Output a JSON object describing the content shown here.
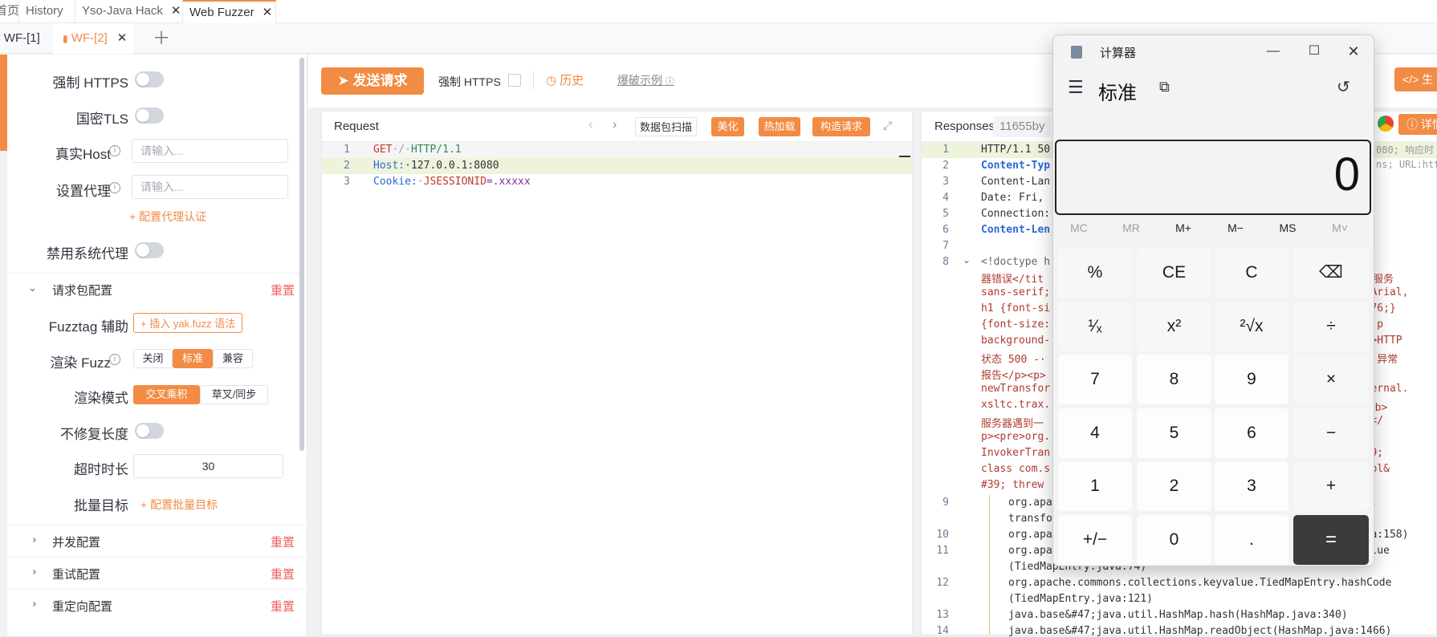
{
  "top_tabs": [
    {
      "label": "首页"
    },
    {
      "label": "History"
    },
    {
      "label": "Yso-Java Hack"
    },
    {
      "label": "Web Fuzzer"
    }
  ],
  "sub_tabs": [
    {
      "label": "WF-[1]"
    },
    {
      "label": "WF-[2]"
    }
  ],
  "left": {
    "force_https": "强制 HTTPS",
    "gm_tls": "国密TLS",
    "real_host": "真实Host",
    "real_host_placeholder": "请输入...",
    "proxy": "设置代理",
    "proxy_placeholder": "请输入...",
    "proxy_auth_link": "+ 配置代理认证",
    "disable_sys_proxy": "禁用系统代理",
    "req_pkg_config": "请求包配置",
    "reset": "重置",
    "fuzztag_helper": "Fuzztag 辅助",
    "insert_fuzz": "+ 插入 yak.fuzz 语法",
    "render_fuzz": "渲染 Fuzz",
    "render_opts": [
      "关闭",
      "标准",
      "兼容"
    ],
    "render_mode": "渲染模式",
    "mode_opts": [
      "交叉乘积",
      "草叉/同步"
    ],
    "no_fix_len": "不修复长度",
    "timeout": "超时时长",
    "timeout_value": "30",
    "batch_target": "批量目标",
    "batch_link": "+ 配置批量目标",
    "concurrency": "并发配置",
    "retry": "重试配置",
    "redirect": "重定向配置"
  },
  "toolbar": {
    "send": "发送请求",
    "force_https": "强制 HTTPS",
    "history": "历史",
    "example": "爆破示例",
    "generate": "生"
  },
  "request": {
    "title": "Request",
    "btn_scan": "数据包扫描",
    "btn_beautify": "美化",
    "btn_hotload": "热加载",
    "btn_build": "构造请求",
    "lines": [
      {
        "n": "1",
        "parts": [
          [
            "GET",
            "#c0392b"
          ],
          [
            "·/·",
            "#999"
          ],
          [
            "HTTP/1.1",
            "#2e8b57"
          ]
        ]
      },
      {
        "n": "2",
        "parts": [
          [
            "Host:",
            "#2a6ad4"
          ],
          [
            "·127.0.0.1:8080",
            "#333"
          ]
        ]
      },
      {
        "n": "3",
        "parts": [
          [
            "Cookie:",
            "#2a6ad4"
          ],
          [
            "·",
            "#999"
          ],
          [
            "JSESSIONID",
            "#c0392b"
          ],
          [
            "=.xxxxx",
            "#7a2f9e"
          ]
        ]
      }
    ]
  },
  "response": {
    "title": "Responses",
    "size": "11655by",
    "detail_btn": "详情",
    "meta1": "080; 响应时",
    "meta2": "ns; URL:htt",
    "lines": [
      {
        "n": "1",
        "text": "HTTP/1.1 50",
        "color": "#333"
      },
      {
        "n": "2",
        "text": "Content-Typ",
        "color": "#2a6ad4",
        "bold": true
      },
      {
        "n": "3",
        "text": "Content-Lan",
        "color": "#333"
      },
      {
        "n": "4",
        "text": "Date: Fri,",
        "color": "#333"
      },
      {
        "n": "5",
        "text": "Connection:",
        "color": "#333"
      },
      {
        "n": "6",
        "text": "Content-Len",
        "color": "#2a6ad4",
        "bold": true
      },
      {
        "n": "7",
        "text": "",
        "color": "#333"
      },
      {
        "n": "8",
        "text": "<!doctype h",
        "color": "#666"
      }
    ],
    "wrap_left": [
      "器错误</tit",
      "sans-serif;",
      "h1 {font-si",
      "{font-size:",
      "background-",
      "状态 500 -·",
      "报告</p><p>",
      "newTransfor",
      "xsltc.trax.",
      "服务器遇到一",
      "p><pre>org.",
      "InvokerTran",
      "class com.s",
      "#39; threw"
    ],
    "wrap_right": [
      "内部服务",
      "ma,Arial,",
      "25D76;}",
      "k;} p",
      "<h1>HTTP",
      "/b> 异常",
      "",
      "internal.",
      "述</b>",
      "/b></",
      "",
      "&#39;",
      "sImpl&",
      ""
    ],
    "tail": [
      {
        "n": "9",
        "text": "org.apa",
        "right": "mer."
      },
      {
        "n": "",
        "text": "transfo",
        "right": ""
      },
      {
        "n": "10",
        "text": "org.apa",
        "right": "java:158)"
      },
      {
        "n": "11",
        "text": "org.apa",
        "right": "tValue"
      },
      {
        "n": "",
        "text": "(TiedMapEntry.java:74)",
        "right": ""
      },
      {
        "n": "12",
        "text": "org.apache.commons.collections.keyvalue.TiedMapEntry.hashCode",
        "right": ""
      },
      {
        "n": "",
        "text": "(TiedMapEntry.java:121)",
        "right": ""
      },
      {
        "n": "13",
        "text": "java.base&#47;java.util.HashMap.hash(HashMap.java:340)",
        "right": ""
      },
      {
        "n": "14",
        "text": "java.base&#47;java.util.HashMap.readObject(HashMap.java:1466)",
        "right": ""
      }
    ]
  },
  "calculator": {
    "title": "计算器",
    "mode": "标准",
    "display": "0",
    "memory": [
      {
        "label": "MC",
        "enabled": false
      },
      {
        "label": "MR",
        "enabled": false
      },
      {
        "label": "M+",
        "enabled": true
      },
      {
        "label": "M−",
        "enabled": true
      },
      {
        "label": "MS",
        "enabled": true
      },
      {
        "label": "M˅",
        "enabled": false
      }
    ],
    "keys": [
      [
        "%",
        "CE",
        "C",
        "⌫"
      ],
      [
        "¹⁄ₓ",
        "x²",
        "²√x",
        "÷"
      ],
      [
        "7",
        "8",
        "9",
        "×"
      ],
      [
        "4",
        "5",
        "6",
        "−"
      ],
      [
        "1",
        "2",
        "3",
        "+"
      ],
      [
        "+/−",
        "0",
        ".",
        "="
      ]
    ]
  }
}
